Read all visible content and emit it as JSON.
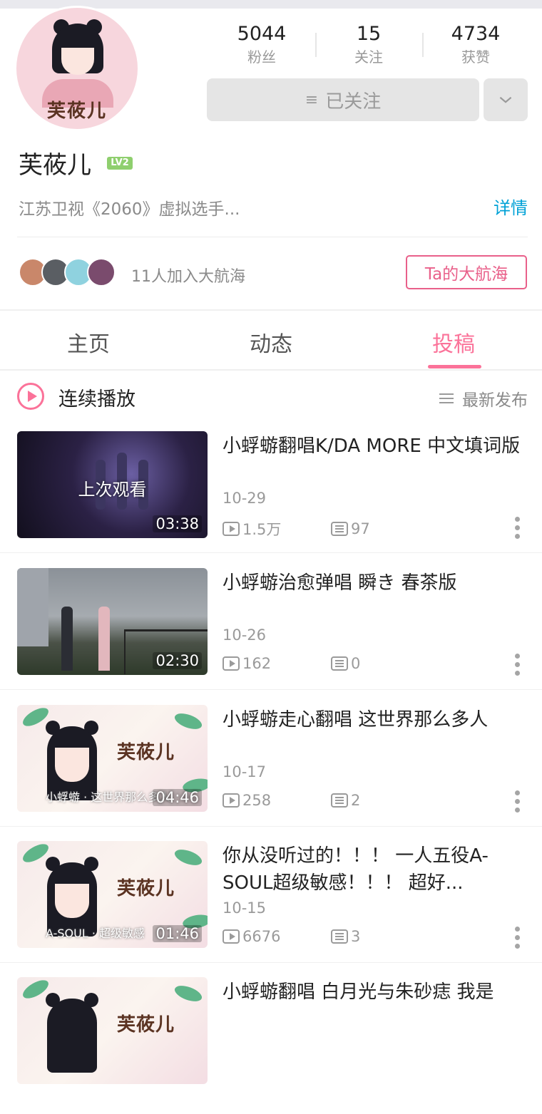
{
  "profile": {
    "avatar_text": "芙莜儿",
    "username": "芙莜儿",
    "level_badge": "LV2",
    "bio": "江苏卫视《2060》虚拟选手...",
    "detail_link": "详情",
    "stats": [
      {
        "value": "5044",
        "label": "粉丝"
      },
      {
        "value": "15",
        "label": "关注"
      },
      {
        "value": "4734",
        "label": "获赞"
      }
    ],
    "follow_button": "已关注",
    "fans_text": "11人加入大航海",
    "voyage_button": "Ta的大航海"
  },
  "tabs": [
    "主页",
    "动态",
    "投稿"
  ],
  "active_tab": "投稿",
  "playbar": {
    "continuous_play": "连续播放",
    "sort": "最新发布"
  },
  "videos": [
    {
      "title": "小蜉蝣翻唱K/DA MORE 中文填词版",
      "date": "10-29",
      "plays": "1.5万",
      "danmaku": "97",
      "duration": "03:38",
      "overlay": "上次观看"
    },
    {
      "title": "小蜉蝣治愈弹唱  瞬き 春茶版",
      "date": "10-26",
      "plays": "162",
      "danmaku": "0",
      "duration": "02:30"
    },
    {
      "title": "小蜉蝣走心翻唱  这世界那么多人",
      "date": "10-17",
      "plays": "258",
      "danmaku": "2",
      "duration": "04:46",
      "thumb_text": "芙莜儿",
      "thumb_sub": "小蜉蝣 · 这世界那么多人"
    },
    {
      "title": "你从没听过的！！！ 一人五役A-SOUL超级敏感！！！ 超好...",
      "date": "10-15",
      "plays": "6676",
      "danmaku": "3",
      "duration": "01:46",
      "thumb_text": "芙莜儿",
      "thumb_sub": "A-SOUL · 超级敏感"
    },
    {
      "title": "小蜉蝣翻唱 白月光与朱砂痣 我是",
      "date": "",
      "plays": "",
      "danmaku": "",
      "duration": "",
      "thumb_text": "芙莜儿"
    }
  ],
  "colors": {
    "accent_pink": "#fb7299",
    "link_blue": "#00a1d6",
    "level_green": "#8fcf6e"
  }
}
